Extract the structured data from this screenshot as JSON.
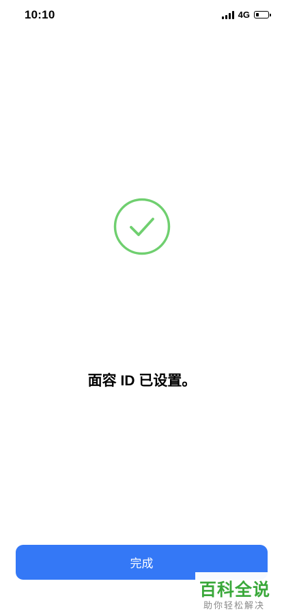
{
  "status_bar": {
    "time": "10:10",
    "network": "4G",
    "icons": [
      "signal-icon",
      "battery-icon"
    ]
  },
  "main": {
    "check_icon": "checkmark-circle-icon",
    "accent_color": "#6FCF6F",
    "message": "面容 ID 已设置。"
  },
  "footer": {
    "done_label": "完成",
    "button_color": "#3478F6"
  },
  "watermark": {
    "title": "百科全说",
    "subtitle": "助你轻松解决"
  }
}
